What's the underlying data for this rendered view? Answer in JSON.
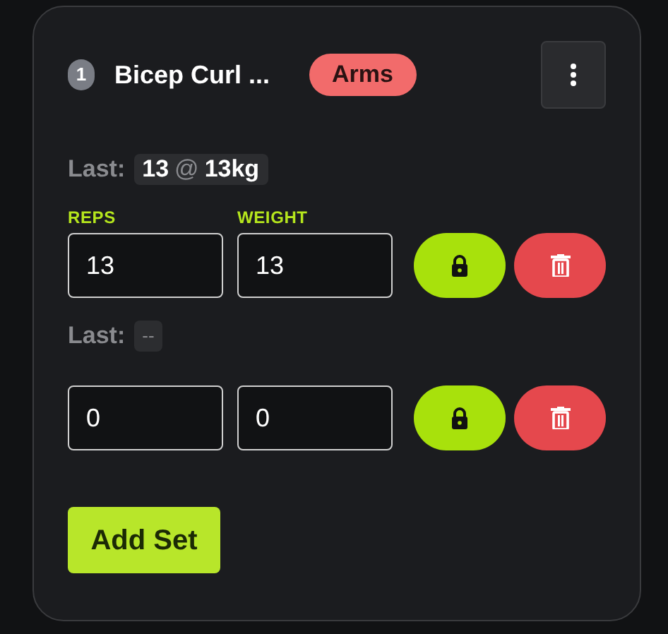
{
  "exercise": {
    "number": "1",
    "name": "Bicep Curl ...",
    "tag": {
      "label": "Arms",
      "color": "#f26b6b"
    }
  },
  "columns": [
    "REPS",
    "WEIGHT"
  ],
  "sets": [
    {
      "last": {
        "kind": "previous",
        "reps": "13",
        "at": "@",
        "weight": "13kg"
      },
      "label": "Last:",
      "reps": "13",
      "weight": "13"
    },
    {
      "last": {
        "kind": "none",
        "text": "--"
      },
      "label": "Last:",
      "reps": "0",
      "weight": "0"
    }
  ],
  "add_button": "Add Set"
}
